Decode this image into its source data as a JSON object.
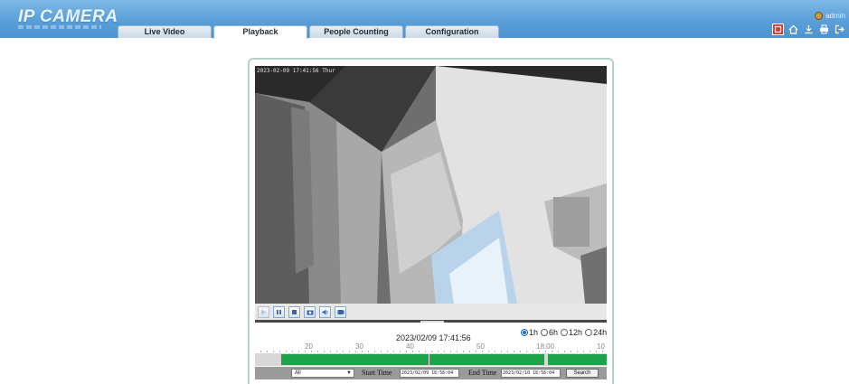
{
  "app": {
    "logo_text": "IP CAMERA"
  },
  "tabs": [
    {
      "label": "Live Video",
      "active": false
    },
    {
      "label": "Playback",
      "active": true
    },
    {
      "label": "People Counting",
      "active": false
    },
    {
      "label": "Configuration",
      "active": false
    }
  ],
  "user": {
    "name": "admin"
  },
  "header_icons": [
    "alarm-icon",
    "home-icon",
    "download-icon",
    "print-icon",
    "logout-icon"
  ],
  "video": {
    "osd_text": "2023-02-09 17:41:56 Thur"
  },
  "controls": [
    "play-icon",
    "pause-icon",
    "stop-icon",
    "snapshot-icon",
    "volume-icon",
    "clip-icon"
  ],
  "playback": {
    "datetime": "2023/02/09 17:41:56",
    "ranges": [
      {
        "label": "1h",
        "selected": true
      },
      {
        "label": "6h",
        "selected": false
      },
      {
        "label": "12h",
        "selected": false
      },
      {
        "label": "24h",
        "selected": false
      }
    ],
    "ticks": [
      "20",
      "30",
      "40",
      "50",
      "18:00",
      "10"
    ]
  },
  "filter": {
    "type_value": "All",
    "start_label": "Start Time",
    "start_value": "2023/02/09 16:56:04",
    "end_label": "End Time",
    "end_value": "2023/02/10 16:56:04",
    "search_label": "Search"
  },
  "colors": {
    "header": "#5a9fd8",
    "record": "#1fa34a",
    "alarm": "#d63a3a"
  }
}
